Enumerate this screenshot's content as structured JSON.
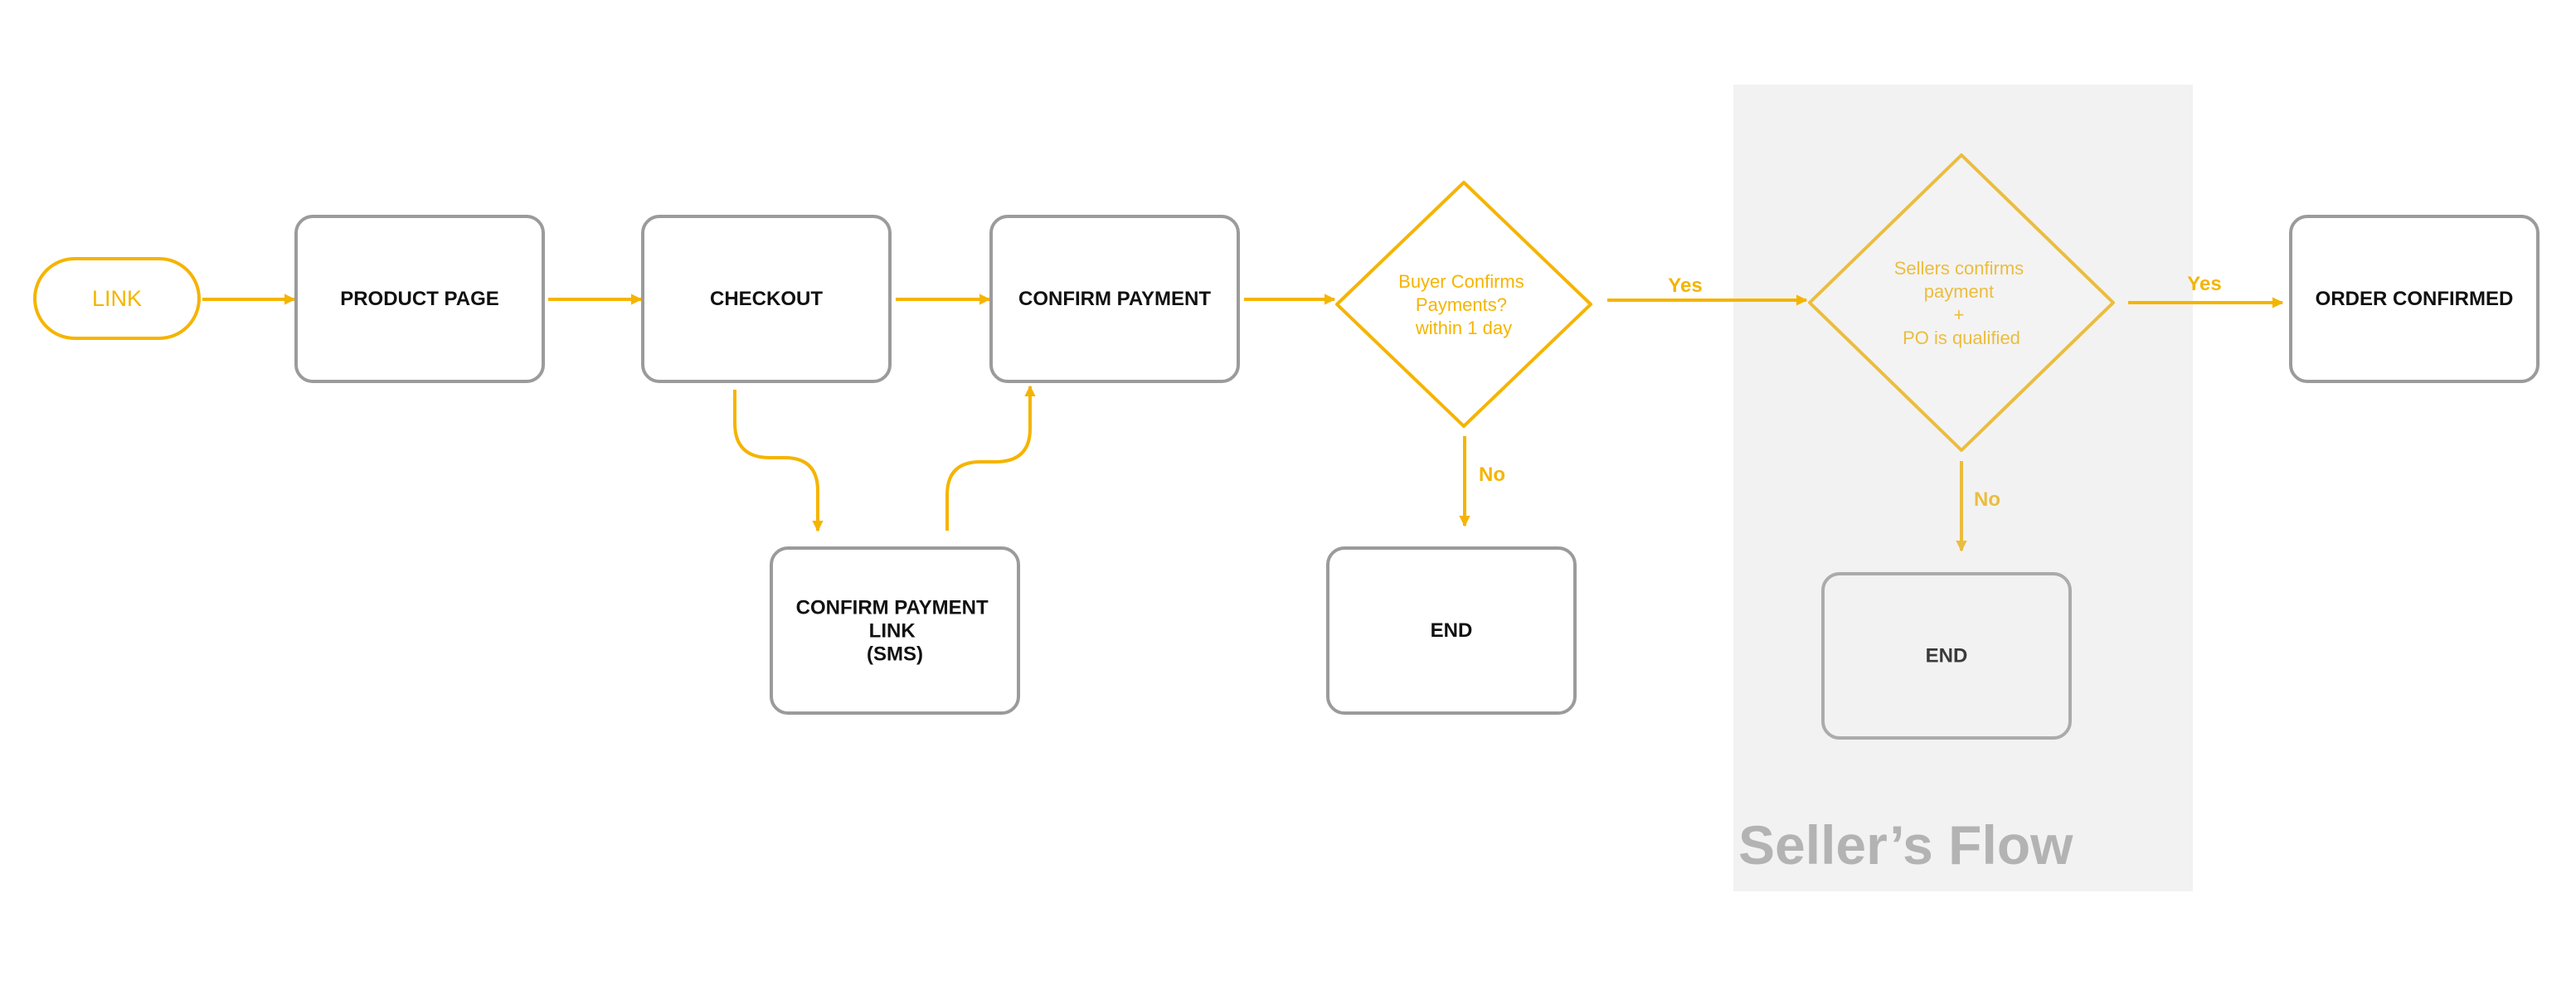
{
  "colors": {
    "accent": "#f5b400",
    "accent_muted": "#ebbd3f",
    "box_border": "#9b9b9b",
    "box_border_muted": "#ababab",
    "zone_fill": "#f2f2f2",
    "zone_title": "#b3b3b3"
  },
  "zone": {
    "title": "Seller’s Flow"
  },
  "nodes": {
    "start": {
      "label": "LINK",
      "shape": "terminator"
    },
    "product_page": {
      "label": "PRODUCT PAGE",
      "shape": "process"
    },
    "checkout": {
      "label": "CHECKOUT",
      "shape": "process"
    },
    "confirm_payment": {
      "label": "CONFIRM PAYMENT",
      "shape": "process"
    },
    "confirm_payment_link": {
      "label_lines": [
        "CONFIRM PAYMENT",
        "LINK",
        "(SMS)"
      ],
      "shape": "process"
    },
    "buyer_decision": {
      "label_lines": [
        "Buyer Confirms",
        "Payments?",
        "within 1 day"
      ],
      "shape": "decision"
    },
    "end_buyer": {
      "label": "END",
      "shape": "process"
    },
    "seller_decision": {
      "label_lines": [
        "Sellers confirms",
        "payment",
        "+",
        "PO is qualified"
      ],
      "shape": "decision"
    },
    "end_seller": {
      "label": "END",
      "shape": "process"
    },
    "order_confirmed": {
      "label": "ORDER CONFIRMED",
      "shape": "process"
    }
  },
  "edges": [
    {
      "from": "start",
      "to": "product_page",
      "label": ""
    },
    {
      "from": "product_page",
      "to": "checkout",
      "label": ""
    },
    {
      "from": "checkout",
      "to": "confirm_payment",
      "label": ""
    },
    {
      "from": "checkout",
      "to": "confirm_payment_link",
      "label": ""
    },
    {
      "from": "confirm_payment_link",
      "to": "confirm_payment",
      "label": ""
    },
    {
      "from": "confirm_payment",
      "to": "buyer_decision",
      "label": ""
    },
    {
      "from": "buyer_decision",
      "to": "seller_decision",
      "label": "Yes"
    },
    {
      "from": "buyer_decision",
      "to": "end_buyer",
      "label": "No"
    },
    {
      "from": "seller_decision",
      "to": "order_confirmed",
      "label": "Yes"
    },
    {
      "from": "seller_decision",
      "to": "end_seller",
      "label": "No"
    }
  ],
  "edge_labels": {
    "buyer_yes": "Yes",
    "buyer_no": "No",
    "seller_yes": "Yes",
    "seller_no": "No"
  }
}
